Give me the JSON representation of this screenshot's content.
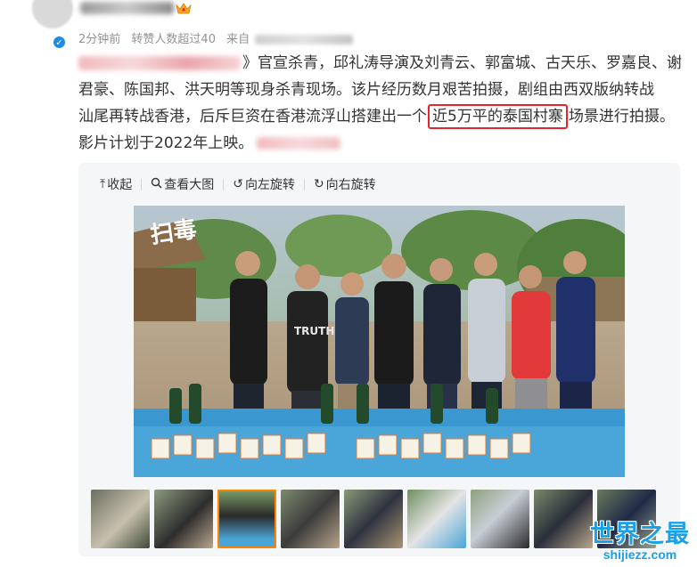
{
  "post": {
    "time": "2分钟前",
    "reposts": "转赞人数超过40",
    "source_prefix": "来自",
    "line1": "官宣杀青，邱礼涛导演及刘青云、郭富城、古天乐、罗嘉良、谢",
    "line1_prefix": "》",
    "line2": "君豪、陈国邦、洪天明等现身杀青现场。该片经历数月艰苦拍摄，剧组由西双版纳转战",
    "line3_before": "汕尾再转战香港，后斥巨资在香港流浮山搭建出一个",
    "line3_highlight": "近5万平的泰国村寨",
    "line3_after": "场景进行拍摄。",
    "line4": "影片计划于2022年上映。"
  },
  "toolbar": {
    "collapse": "收起",
    "view_large": "查看大图",
    "rotate_left": "向左旋转",
    "rotate_right": "向右旋转"
  },
  "photo": {
    "logo_text": "扫毒",
    "shirt_text": "TRUTH"
  },
  "thumbnails": {
    "count": 9,
    "active_index": 2
  },
  "watermark": {
    "title": "世界之最",
    "url": "shijiezz.com"
  },
  "colors": {
    "highlight_border": "#e8232b",
    "verified": "#1f8be6",
    "active_thumb": "#ff8200",
    "watermark": "#1aa0e8"
  }
}
